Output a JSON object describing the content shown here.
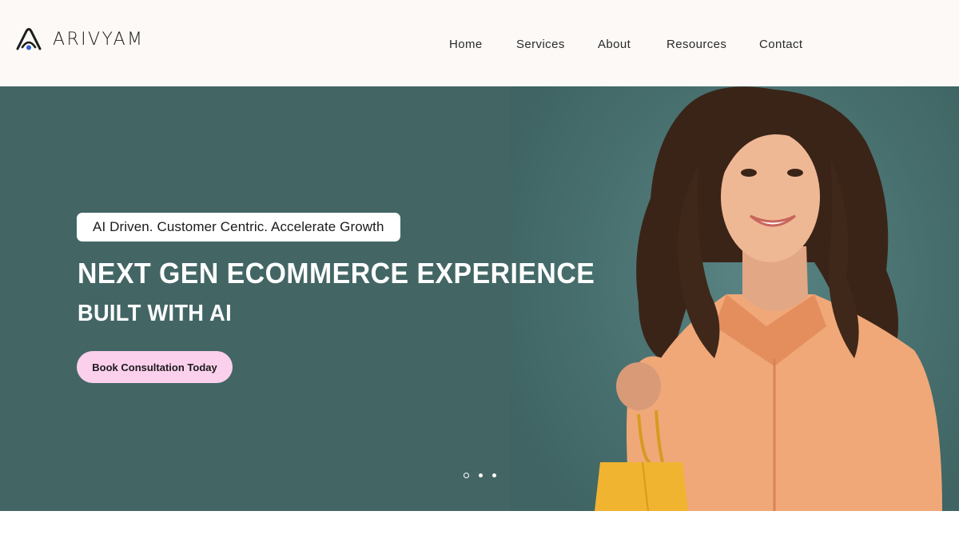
{
  "brand": {
    "name": "ARIVYAM"
  },
  "nav": {
    "items": [
      {
        "label": "Home"
      },
      {
        "label": "Services"
      },
      {
        "label": "About"
      },
      {
        "label": "Resources"
      },
      {
        "label": "Contact"
      }
    ]
  },
  "hero": {
    "tagline": "AI Driven. Customer Centric. Accelerate Growth",
    "title_line1": "NEXT GEN ECOMMERCE EXPERIENCE",
    "title_line2": "BUILT WITH AI",
    "cta_label": "Book Consultation Today",
    "slider": {
      "count": 3,
      "active_index": 0
    }
  },
  "colors": {
    "header_bg": "#fdf9f6",
    "hero_bg": "#436665",
    "cta_bg": "#fbd0ec",
    "logo_dot": "#2f5fd6"
  },
  "icons": {
    "logo": "arivyam-logo-icon"
  }
}
